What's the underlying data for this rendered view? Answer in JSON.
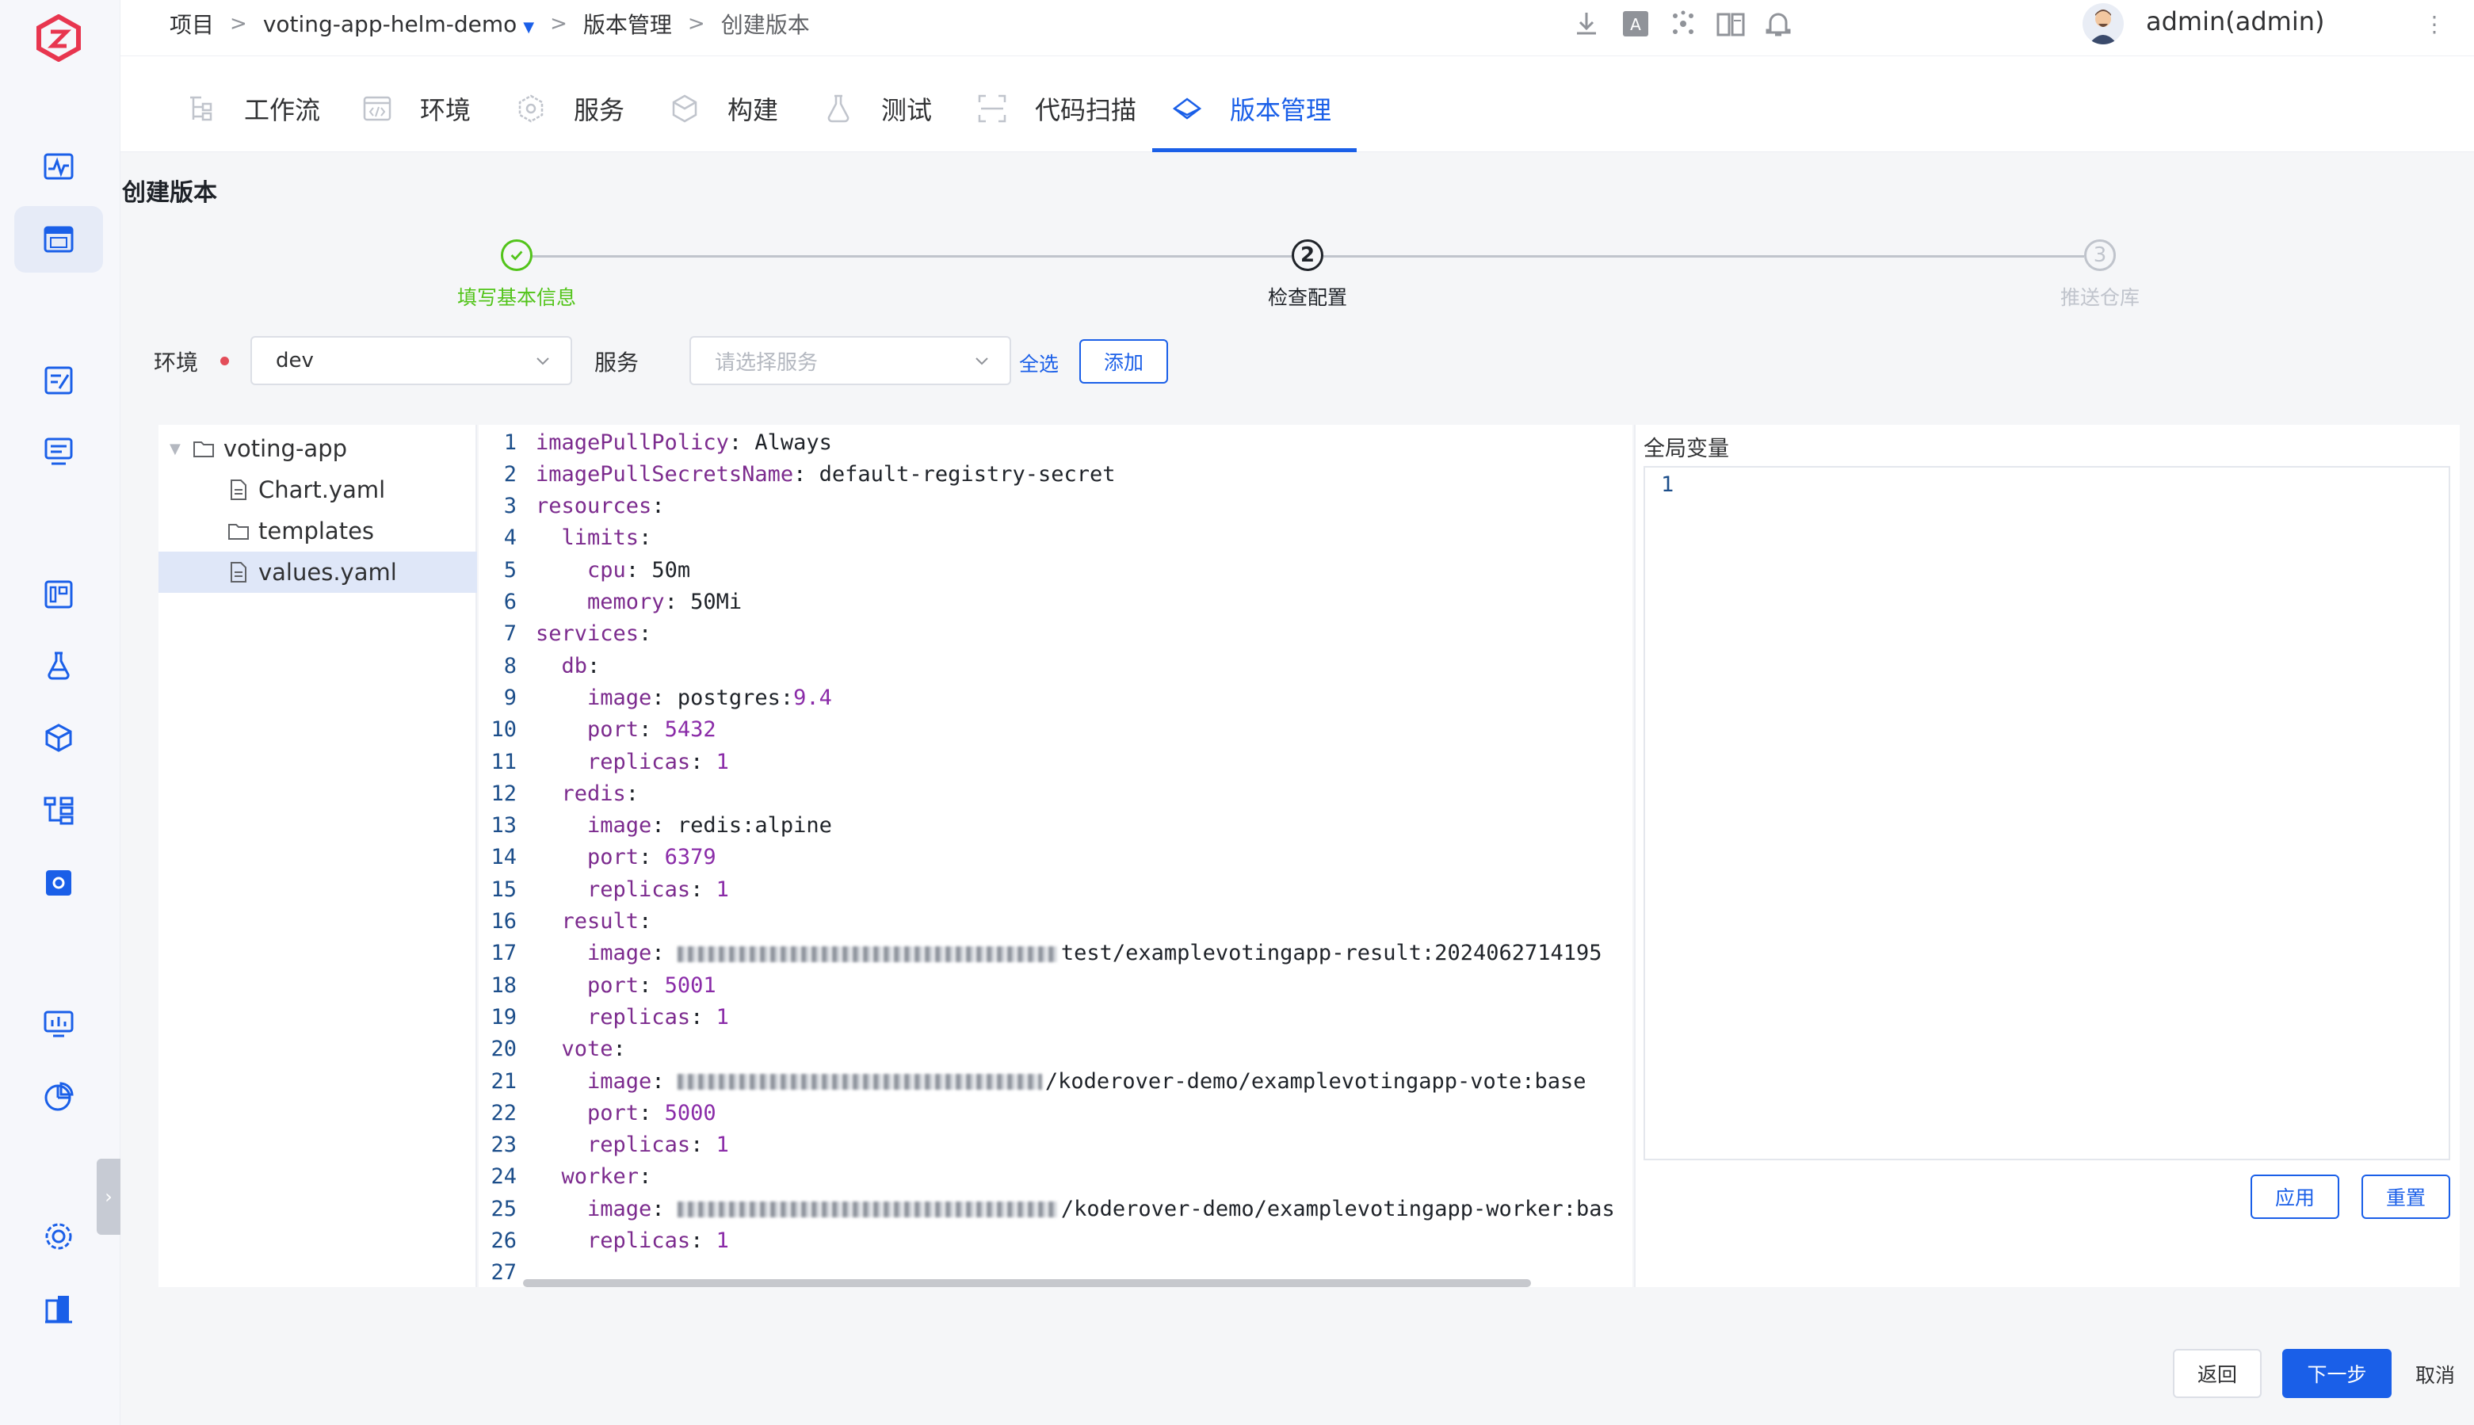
{
  "breadcrumb": {
    "project": "项目",
    "app": "voting-app-helm-demo",
    "section": "版本管理",
    "current": "创建版本"
  },
  "user": {
    "name": "admin(admin)"
  },
  "module_tabs": [
    {
      "label": "工作流",
      "icon": "workflow-icon"
    },
    {
      "label": "环境",
      "icon": "environment-icon"
    },
    {
      "label": "服务",
      "icon": "service-icon"
    },
    {
      "label": "构建",
      "icon": "build-icon"
    },
    {
      "label": "测试",
      "icon": "test-icon"
    },
    {
      "label": "代码扫描",
      "icon": "code-scan-icon"
    },
    {
      "label": "版本管理",
      "icon": "version-icon",
      "active": true
    }
  ],
  "page_title": "创建版本",
  "steps": [
    {
      "label": "填写基本信息",
      "status": "done"
    },
    {
      "label": "检查配置",
      "number": "2",
      "status": "active"
    },
    {
      "label": "推送仓库",
      "number": "3",
      "status": "pending"
    }
  ],
  "filters": {
    "env_label": "环境",
    "env_value": "dev",
    "service_label": "服务",
    "service_placeholder": "请选择服务",
    "select_all": "全选",
    "add": "添加"
  },
  "tree": [
    {
      "name": "voting-app",
      "type": "folder",
      "level": 0
    },
    {
      "name": "Chart.yaml",
      "type": "file",
      "level": 1
    },
    {
      "name": "templates",
      "type": "folder",
      "level": 1
    },
    {
      "name": "values.yaml",
      "type": "file",
      "level": 1,
      "selected": true
    }
  ],
  "code": [
    {
      "n": "1",
      "indent": "",
      "key": "imagePullPolicy",
      "val": "Always"
    },
    {
      "n": "2",
      "indent": "",
      "key": "imagePullSecretsName",
      "val": "default-registry-secret"
    },
    {
      "n": "3",
      "indent": "",
      "key": "resources",
      "val": ""
    },
    {
      "n": "4",
      "indent": "  ",
      "key": "limits",
      "val": ""
    },
    {
      "n": "5",
      "indent": "    ",
      "key": "cpu",
      "val": "50m"
    },
    {
      "n": "6",
      "indent": "    ",
      "key": "memory",
      "val": "50Mi"
    },
    {
      "n": "7",
      "indent": "",
      "key": "services",
      "val": ""
    },
    {
      "n": "8",
      "indent": "  ",
      "key": "db",
      "val": ""
    },
    {
      "n": "9",
      "indent": "    ",
      "key": "image",
      "val": "postgres:",
      "num": "9.4"
    },
    {
      "n": "10",
      "indent": "    ",
      "key": "port",
      "val": "",
      "num": "5432"
    },
    {
      "n": "11",
      "indent": "    ",
      "key": "replicas",
      "val": "",
      "num": "1"
    },
    {
      "n": "12",
      "indent": "  ",
      "key": "redis",
      "val": ""
    },
    {
      "n": "13",
      "indent": "    ",
      "key": "image",
      "val": "redis:alpine"
    },
    {
      "n": "14",
      "indent": "    ",
      "key": "port",
      "val": "",
      "num": "6379"
    },
    {
      "n": "15",
      "indent": "    ",
      "key": "replicas",
      "val": "",
      "num": "1"
    },
    {
      "n": "16",
      "indent": "  ",
      "key": "result",
      "val": ""
    },
    {
      "n": "17",
      "indent": "    ",
      "key": "image",
      "blur": true,
      "val": "test/examplevotingapp-result:2024062714195"
    },
    {
      "n": "18",
      "indent": "    ",
      "key": "port",
      "val": "",
      "num": "5001"
    },
    {
      "n": "19",
      "indent": "    ",
      "key": "replicas",
      "val": "",
      "num": "1"
    },
    {
      "n": "20",
      "indent": "  ",
      "key": "vote",
      "val": ""
    },
    {
      "n": "21",
      "indent": "    ",
      "key": "image",
      "blur": true,
      "val": "/koderover-demo/examplevotingapp-vote:base"
    },
    {
      "n": "22",
      "indent": "    ",
      "key": "port",
      "val": "",
      "num": "5000"
    },
    {
      "n": "23",
      "indent": "    ",
      "key": "replicas",
      "val": "",
      "num": "1"
    },
    {
      "n": "24",
      "indent": "  ",
      "key": "worker",
      "val": ""
    },
    {
      "n": "25",
      "indent": "    ",
      "key": "image",
      "blur": true,
      "val": "/koderover-demo/examplevotingapp-worker:bas"
    },
    {
      "n": "26",
      "indent": "    ",
      "key": "replicas",
      "val": "",
      "num": "1"
    },
    {
      "n": "27",
      "indent": "",
      "key": "",
      "val": ""
    }
  ],
  "vars": {
    "title": "全局变量",
    "line_number": "1",
    "apply": "应用",
    "reset": "重置"
  },
  "footer": {
    "back": "返回",
    "next": "下一步",
    "cancel": "取消"
  },
  "colors": {
    "primary": "#1a5fe8",
    "success": "#52c41a",
    "danger": "#e34d59"
  }
}
